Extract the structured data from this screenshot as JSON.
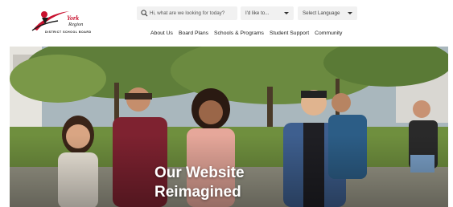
{
  "logo": {
    "name": "York",
    "region": "Region",
    "subtitle": "DISTRICT SCHOOL BOARD"
  },
  "search": {
    "placeholder": "Hi, what are we looking for today?"
  },
  "dropdowns": {
    "like": "I'd like to...",
    "language": "Select Language"
  },
  "nav": {
    "items": [
      "About Us",
      "Board Plans",
      "Schools & Programs",
      "Student Support",
      "Community"
    ]
  },
  "hero": {
    "headline_line1": "Our Website",
    "headline_line2": "Reimagined"
  },
  "colors": {
    "brand_red": "#c8102e",
    "nav_text": "#1a1a1a",
    "field_bg": "#f1f1f1"
  }
}
